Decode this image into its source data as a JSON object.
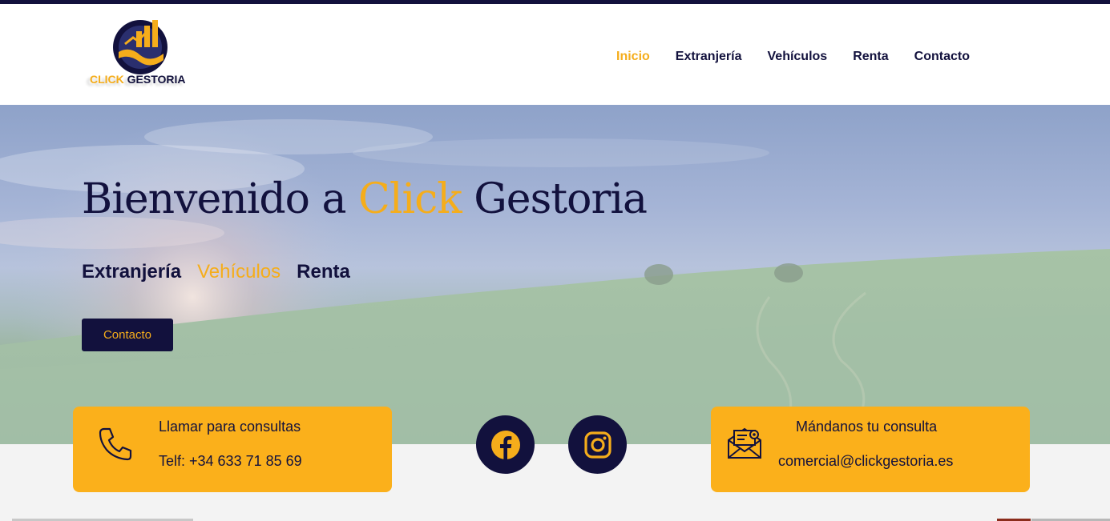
{
  "brand": {
    "logo_word_1": "CLICK",
    "logo_word_2": "GESTORIA",
    "primary_color": "#12113d",
    "accent_color": "#f5ad1b"
  },
  "nav": {
    "items": [
      {
        "label": "Inicio",
        "active": true
      },
      {
        "label": "Extranjería",
        "active": false
      },
      {
        "label": "Vehículos",
        "active": false
      },
      {
        "label": "Renta",
        "active": false
      },
      {
        "label": "Contacto",
        "active": false
      }
    ]
  },
  "hero": {
    "title_part_1": "Bienvenido a ",
    "title_highlight": "Click",
    "title_part_2": " Gestoria",
    "services": [
      "Extranjería",
      "Vehículos",
      "Renta"
    ],
    "button_label": "Contacto"
  },
  "contact_cards": {
    "phone": {
      "title": "Llamar para consultas",
      "value": "Telf: +34 633 71 85 69",
      "icon": "phone-icon"
    },
    "email": {
      "title": "Mándanos tu consulta",
      "value": "comercial@clickgestoria.es",
      "icon": "envelope-icon"
    }
  },
  "social": {
    "facebook_icon": "facebook-icon",
    "instagram_icon": "instagram-icon"
  }
}
